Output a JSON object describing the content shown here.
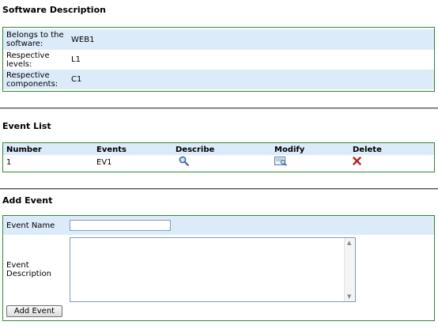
{
  "software_description": {
    "title": "Software Description",
    "rows": [
      {
        "label": "Belongs to the software:",
        "value": "WEB1"
      },
      {
        "label": "Respective levels:",
        "value": "L1"
      },
      {
        "label": "Respective components:",
        "value": "C1"
      }
    ]
  },
  "event_list": {
    "title": "Event List",
    "columns": [
      "Number",
      "Events",
      "Describe",
      "Modify",
      "Delete"
    ],
    "rows": [
      {
        "number": "1",
        "event": "EV1",
        "describe_icon": "magnifier-icon",
        "modify_icon": "edit-icon",
        "delete_icon": "red-x-icon"
      }
    ]
  },
  "add_event": {
    "title": "Add Event",
    "name_label": "Event Name",
    "name_value": "",
    "description_label": "Event Description",
    "description_value": "",
    "submit_label": "Add Event"
  },
  "colors": {
    "row_highlight": "#dcebfa",
    "box_border": "#2e8b2e",
    "delete": "#b22222"
  }
}
